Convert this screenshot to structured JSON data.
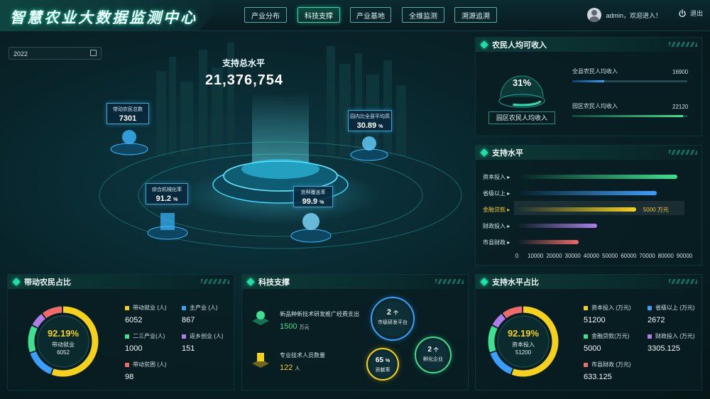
{
  "app": {
    "title": "智慧农业大数据监测中心"
  },
  "nav": {
    "tabs": [
      {
        "label": "产业分布",
        "active": false
      },
      {
        "label": "科技支撑",
        "active": true
      },
      {
        "label": "产业基地",
        "active": false
      },
      {
        "label": "全维监测",
        "active": false
      },
      {
        "label": "溯源追溯",
        "active": false
      }
    ]
  },
  "user": {
    "greeting": "admin，欢迎进入！",
    "logout": "退出"
  },
  "date_picker": {
    "value": "2022"
  },
  "center": {
    "title": "支持总水平",
    "total": "21,376,754",
    "cards": [
      {
        "label": "带动农民总数",
        "value": "7301",
        "unit": ""
      },
      {
        "label": "园内比全县平均高",
        "value": "30.89",
        "unit": "%"
      },
      {
        "label": "综合机械化率",
        "value": "91.2",
        "unit": "%"
      },
      {
        "label": "良种覆盖率",
        "value": "99.9",
        "unit": "%"
      }
    ]
  },
  "income": {
    "title": "农民人均可收入",
    "percent": "31%",
    "caption": "园区农民人均收入",
    "rows": [
      {
        "label": "全县农民人均收入",
        "value": "16900",
        "fraction": 0.28
      },
      {
        "label": "园区农民人均收入",
        "value": "22120",
        "fraction": 0.96
      }
    ]
  },
  "support": {
    "title": "支持水平",
    "highlight_value": "5000 万元",
    "colors": [
      "#3fe08f",
      "#3aa0ff",
      "#f5d11c",
      "#b07de8",
      "#f06a6a"
    ]
  },
  "chart_data": {
    "type": "bar",
    "orientation": "horizontal",
    "categories": [
      "资本投入",
      "省级以上",
      "金融贷款",
      "财政投入",
      "市县财政"
    ],
    "values": [
      86000,
      75000,
      64000,
      43000,
      33000
    ],
    "xlim": [
      0,
      90000
    ],
    "xticks": [
      "0",
      "10000",
      "20000",
      "30000",
      "40000",
      "50000",
      "60000",
      "70000",
      "80000",
      "90000"
    ],
    "highlight_index": 2
  },
  "farmers": {
    "title": "带动农民占比",
    "percent": "92.19%",
    "center_label": "带动就业",
    "center_value": "6052",
    "items": [
      {
        "label": "带动就业 (人)",
        "value": "6052",
        "color": "#f5d11c"
      },
      {
        "label": "主产业 (人)",
        "value": "867",
        "color": "#3aa0ff"
      },
      {
        "label": "二三产业(人)",
        "value": "1000",
        "color": "#3fe08f"
      },
      {
        "label": "返乡创业 (人)",
        "value": "151",
        "color": "#b07de8"
      },
      {
        "label": "带动贫困 (人)",
        "value": "98",
        "color": "#f06a6a"
      }
    ]
  },
  "tech": {
    "title": "科技支撑",
    "items": [
      {
        "label": "新品种新技术研发推广经费支出",
        "value": "1500",
        "unit": "万元"
      },
      {
        "label": "专业技术人员数量",
        "value": "122",
        "unit": "人"
      }
    ],
    "bubbles": [
      {
        "value": "2",
        "unit": "个",
        "label": "市级研发平台",
        "color": "#3aa0ff"
      },
      {
        "value": "65",
        "unit": "%",
        "label": "贡献率",
        "color": "#f5d11c"
      },
      {
        "value": "2",
        "unit": "个",
        "label": "孵化企业",
        "color": "#3fe08f"
      }
    ]
  },
  "support_ratio": {
    "title": "支持水平占比",
    "percent": "92.19%",
    "center_label": "资本投入",
    "center_value": "51200",
    "items": [
      {
        "label": "资本投入 (万元)",
        "value": "51200",
        "color": "#f5d11c"
      },
      {
        "label": "省级以上 (万元)",
        "value": "2672",
        "color": "#3aa0ff"
      },
      {
        "label": "金融贷款(万元)",
        "value": "5000",
        "color": "#3fe08f"
      },
      {
        "label": "财政投入 (万元)",
        "value": "3305.125",
        "color": "#b07de8"
      },
      {
        "label": "市县财政 (万元)",
        "value": "633.125",
        "color": "#f06a6a"
      }
    ]
  }
}
